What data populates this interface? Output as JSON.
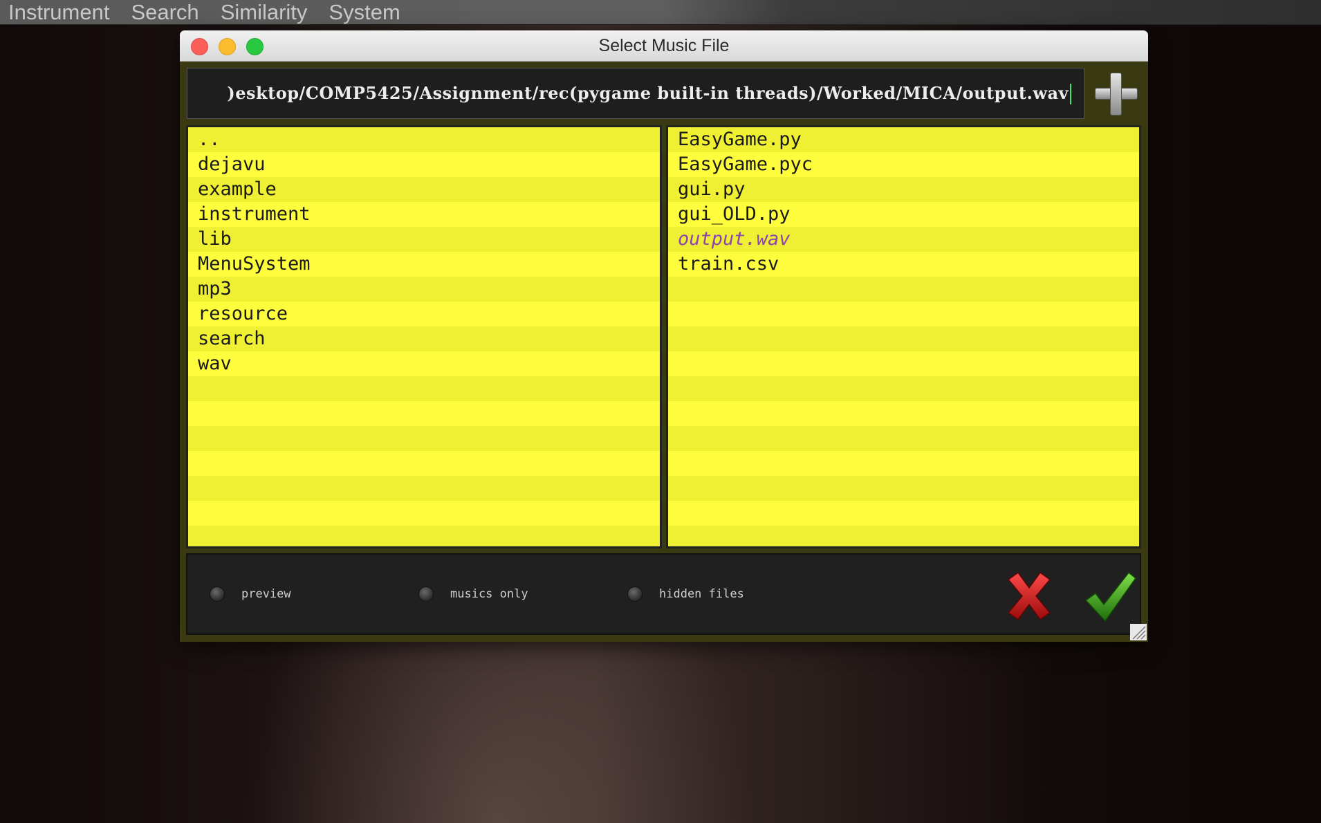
{
  "menubar": {
    "items": [
      "Instrument",
      "Search",
      "Similarity",
      "System"
    ]
  },
  "window": {
    "title": "Select Music File"
  },
  "path_input": {
    "value": ")esktop/COMP5425/Assignment/rec(pygame built-in threads)/Worked/MICA/output.wav"
  },
  "directories": [
    "..",
    "dejavu",
    "example",
    "instrument",
    "lib",
    "MenuSystem",
    "mp3",
    "resource",
    "search",
    "wav"
  ],
  "files": [
    "EasyGame.py",
    "EasyGame.pyc",
    "gui.py",
    "gui_OLD.py",
    "output.wav",
    "train.csv"
  ],
  "selected_file": "output.wav",
  "options": {
    "preview": "preview",
    "musics_only": "musics only",
    "hidden_files": "hidden files"
  },
  "colors": {
    "list_bg": "#f8f836",
    "selected_text": "#8b44b0",
    "cursor": "#3de36a"
  },
  "icons": {
    "add": "plus-icon",
    "cancel": "red-x-icon",
    "confirm": "green-check-icon"
  }
}
